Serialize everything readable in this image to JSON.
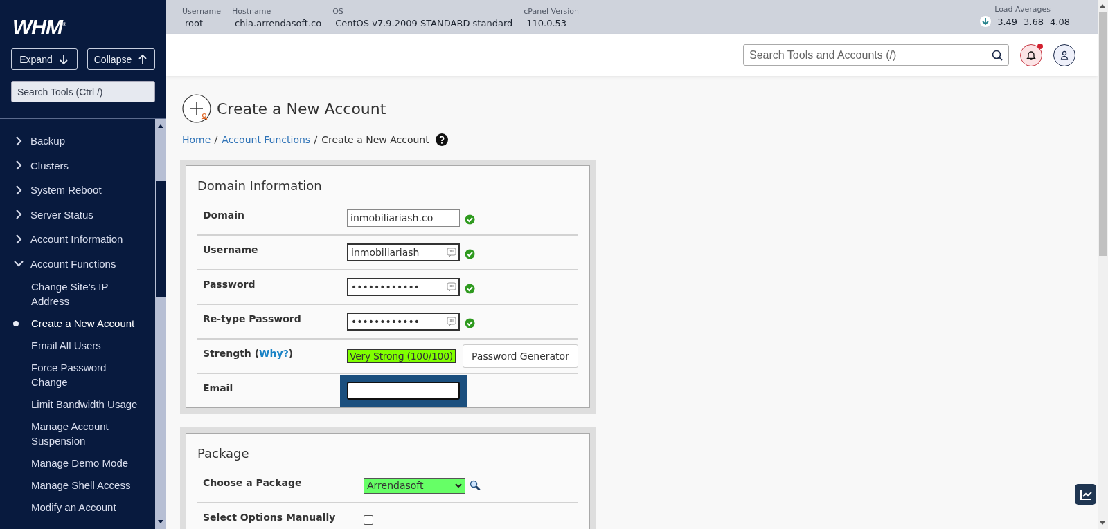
{
  "sidebar": {
    "logo": "WHM$^{®}$",
    "buttons": [
      {
        "label": "Expand",
        "kind": "down"
      },
      {
        "label": "Collapse",
        "kind": "up"
      }
    ],
    "search": {
      "placeholder": "Search Tools (Ctrl /)"
    },
    "items": [
      {
        "label": "Backup",
        "expanded": false
      },
      {
        "label": "Clusters",
        "expanded": false
      },
      {
        "label": "System Reboot",
        "expanded": false
      },
      {
        "label": "Server Status",
        "expanded": false
      },
      {
        "label": "Account Information",
        "expanded": false
      },
      {
        "label": "Account Functions",
        "expanded": true,
        "children": [
          {
            "label": "Change Site’s IP Address",
            "selected": false
          },
          {
            "label": "Create a New Account",
            "selected": true
          },
          {
            "label": "Email All Users",
            "selected": false
          },
          {
            "label": "Force Password Change",
            "selected": false
          },
          {
            "label": "Limit Bandwidth Usage",
            "selected": false
          },
          {
            "label": "Manage Account Suspension",
            "selected": false
          },
          {
            "label": "Manage Demo Mode",
            "selected": false
          },
          {
            "label": "Manage Shell Access",
            "selected": false
          },
          {
            "label": "Modify an Account",
            "selected": false
          }
        ]
      }
    ]
  },
  "server_info": [
    {
      "label": "Username",
      "value": "root"
    },
    {
      "label": "Hostname",
      "value": "chia.arrendasoft.co"
    },
    {
      "label": "OS",
      "value": "CentOS v7.9.2009 STANDARD standard"
    },
    {
      "label": "cPanel Version",
      "value": "110.0.53"
    }
  ],
  "load_averages": {
    "label": "Load Averages",
    "values": [
      "3.49",
      "3.68",
      "4.08"
    ]
  },
  "header": {
    "search": {
      "placeholder": "Search Tools and Accounts (/)"
    },
    "notifications": {
      "unread": true
    }
  },
  "page": {
    "title": "Create a New Account",
    "breadcrumb": [
      {
        "label": "Home",
        "link": true
      },
      {
        "label": "Account Functions",
        "link": true
      },
      {
        "label": "Create a New Account",
        "link": false
      }
    ]
  },
  "sections": [
    {
      "title": "Domain Information",
      "rows": [
        {
          "kind": "text",
          "label": "Domain",
          "value": "inmobiliariash.co",
          "valid": true,
          "autofill": false,
          "focused": false
        },
        {
          "kind": "text",
          "label": "Username",
          "value": "inmobiliariash",
          "valid": true,
          "autofill": true,
          "focused": false
        },
        {
          "kind": "text",
          "label": "Password",
          "value": "••••••••••••",
          "valid": true,
          "autofill": true,
          "focused": false
        },
        {
          "kind": "text",
          "label": "Re-type Password",
          "value": "••••••••••••",
          "valid": true,
          "autofill": true,
          "focused": false
        },
        {
          "kind": "strength",
          "label": "Strength (",
          "link": "Why?",
          "label_end": ")",
          "value": "Very Strong (100/100)",
          "color": "#80ff00",
          "button": "Password Generator"
        },
        {
          "kind": "text",
          "label": "Email",
          "value": "",
          "valid": false,
          "autofill": false,
          "focused": true
        }
      ]
    },
    {
      "title": "Package",
      "rows": [
        {
          "kind": "select",
          "label": "Choose a Package",
          "value": "Arrendasoft",
          "valid": true
        },
        {
          "kind": "checkbox",
          "label": "Select Options Manually",
          "checked": false
        }
      ]
    }
  ]
}
